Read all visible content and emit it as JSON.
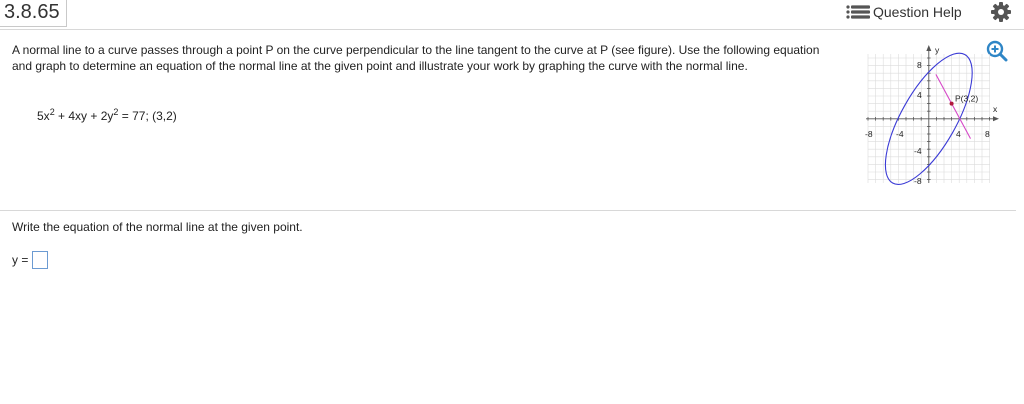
{
  "header": {
    "question_number": "3.8.65",
    "help_label": "Question Help"
  },
  "problem": {
    "prompt": "A normal line to a curve passes through a point P on the curve perpendicular to the line tangent to the curve at P (see figure). Use the following equation and graph to determine an equation of the normal line at the given point and illustrate your work by graphing the curve with the normal line.",
    "equation": {
      "t1": "5x",
      "e1": "2",
      "t2": " + 4xy + 2y",
      "e2": "2",
      "t3": " = 77; (3,2)"
    }
  },
  "graph": {
    "y_axis_label": "y",
    "x_axis_label": "x",
    "point_label": "P(3,2)",
    "x_tick_labels": [
      "-8",
      "-4",
      "4",
      "8"
    ],
    "y_tick_labels": [
      "8",
      "4",
      "-4",
      "-8"
    ],
    "curve_color": "#3b3bd6",
    "normal_line_color": "#d648c8",
    "point_color": "#b0183c"
  },
  "answer": {
    "instruction": "Write the equation of the normal line at the given point.",
    "label": "y =",
    "value": ""
  },
  "icons": {
    "help": "list-icon",
    "settings": "gear-icon",
    "zoom": "zoom-in-icon"
  }
}
